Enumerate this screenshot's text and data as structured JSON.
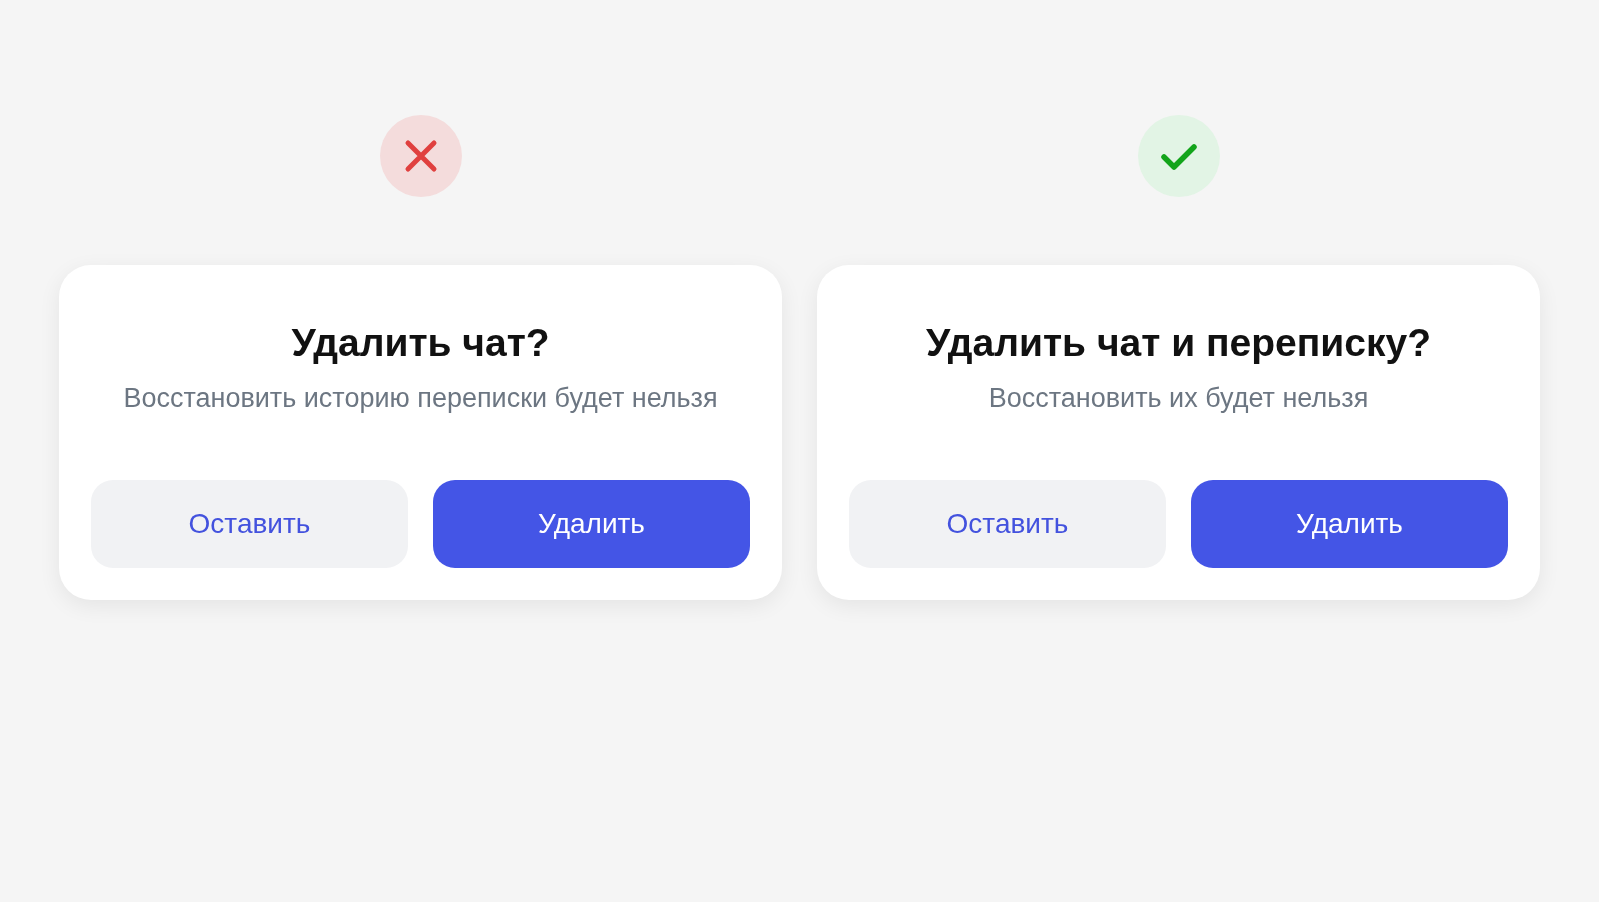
{
  "examples": [
    {
      "kind": "wrong",
      "dialog": {
        "title": "Удалить чат?",
        "message": "Восстановить историю переписки будет нельзя",
        "buttons": [
          {
            "label": "Оставить",
            "kind": "secondary"
          },
          {
            "label": "Удалить",
            "kind": "primary"
          }
        ]
      }
    },
    {
      "kind": "right",
      "dialog": {
        "title": "Удалить чат и переписку?",
        "message": "Восстановить их будет нельзя",
        "buttons": [
          {
            "label": "Оставить",
            "kind": "secondary"
          },
          {
            "label": "Удалить",
            "kind": "primary"
          }
        ]
      }
    }
  ]
}
